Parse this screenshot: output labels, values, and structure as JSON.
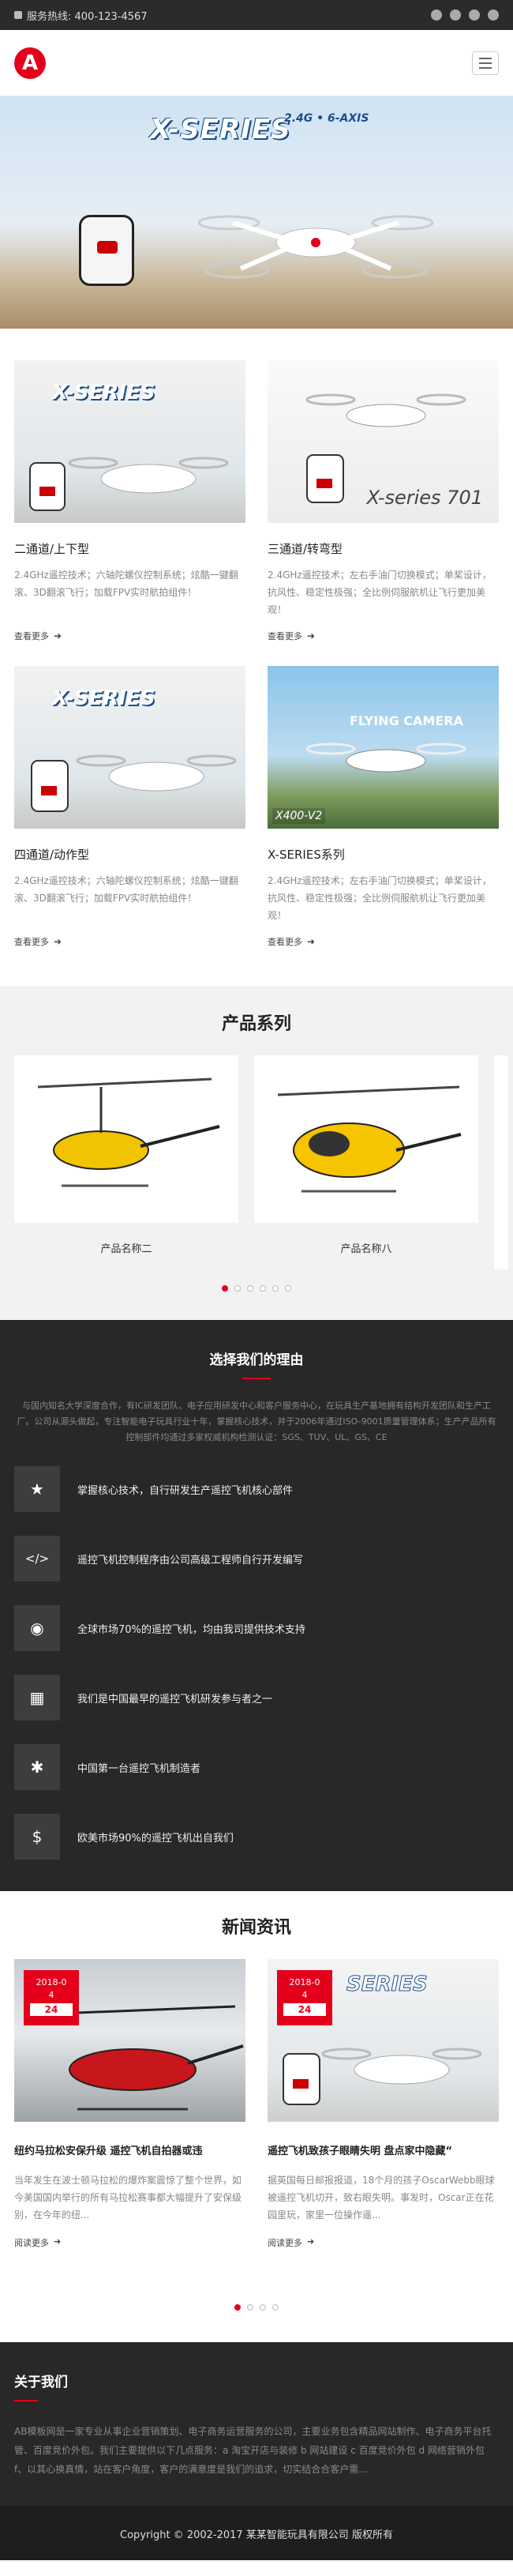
{
  "topbar": {
    "hotline": "服务热线: 400-123-4567",
    "social_icons": [
      "weibo-icon",
      "tencent-weibo-icon",
      "pinterest-icon",
      "qq-icon"
    ]
  },
  "header": {
    "logo_letter": "A",
    "menu_icon": "hamburger-icon"
  },
  "banner": {
    "brand": "X-SERIES",
    "spec": "2.4G • 6-AXIS"
  },
  "products": [
    {
      "title": "二通道/上下型",
      "desc": "2.4GHz遥控技术；六轴陀螺仪控制系统；炫酷一键翻滚、3D翻滚飞行；加载FPV实时航拍组件！",
      "more": "查看更多",
      "overlay": "X-SERIES",
      "tag": ""
    },
    {
      "title": "三通道/转弯型",
      "desc": "2.4GHz遥控技术；左右手油门切换模式；单桨设计，抗风性、稳定性极强；全比例伺服航机让飞行更加美观！",
      "more": "查看更多",
      "overlay": "",
      "tag": "X-series 701"
    },
    {
      "title": "四通道/动作型",
      "desc": "2.4GHz遥控技术；六轴陀螺仪控制系统；炫酷一键翻滚、3D翻滚飞行；加载FPV实时航拍组件！",
      "more": "查看更多",
      "overlay": "X-SERIES",
      "tag": ""
    },
    {
      "title": "X-SERIES系列",
      "desc": "2.4GHz遥控技术；左右手油门切换模式；单桨设计，抗风性、稳定性极强；全比例伺服航机让飞行更加美观！",
      "more": "查看更多",
      "overlay": "FLYING CAMERA",
      "tag": "X400-V2"
    }
  ],
  "series": {
    "title": "产品系列",
    "items": [
      {
        "name": "产品名称二"
      },
      {
        "name": "产品名称八"
      }
    ],
    "dots": 6
  },
  "reasons": {
    "title": "选择我们的理由",
    "intro": "与国内知名大学深度合作，有IC研发团队、电子应用研发中心和客户服务中心，在玩具生产基地拥有结构开发团队和生产工厂。公司从源头做起，专注智能电子玩具行业十年，掌握核心技术，并于2006年通过ISO-9001质量管理体系；生产产品所有控制部件均通过多家权威机构检测认证：SGS、TUV、UL、GS、CE",
    "items": [
      {
        "icon": "star-icon",
        "glyph": "★",
        "text": "掌握核心技术，自行研发生产遥控飞机核心部件"
      },
      {
        "icon": "code-icon",
        "glyph": "</>",
        "text": "遥控飞机控制程序由公司高级工程师自行开发编写"
      },
      {
        "icon": "globe-icon",
        "glyph": "◉",
        "text": "全球市场70%的遥控飞机，均由我司提供技术支持"
      },
      {
        "icon": "calendar-icon",
        "glyph": "▦",
        "text": "我们是中国最早的遥控飞机研发参与者之一"
      },
      {
        "icon": "asterisk-icon",
        "glyph": "✱",
        "text": "中国第一台遥控飞机制造者"
      },
      {
        "icon": "money-icon",
        "glyph": "$",
        "text": "欧美市场90%的遥控飞机出自我们"
      }
    ]
  },
  "news": {
    "title": "新闻资讯",
    "items": [
      {
        "date_ym": "2018-0",
        "date_m": "4",
        "day": "24",
        "title": "纽约马拉松安保升级 遥控飞机自拍器或违",
        "desc": "当年发生在波士顿马拉松的爆炸案震惊了整个世界，如今美国国内举行的所有马拉松赛事都大幅提升了安保级别，在今年的纽...",
        "more": "阅读更多"
      },
      {
        "date_ym": "2018-0",
        "date_m": "4",
        "day": "24",
        "title": "遥控飞机致孩子眼睛失明 盘点家中隐藏“",
        "desc": "据英国每日邮报报道，18个月的孩子OscarWebb眼球被遥控飞机切开，致右眼失明。事发时，Oscar正在花园里玩，家里一位操作遥...",
        "more": "阅读更多"
      }
    ],
    "dots": 4
  },
  "about": {
    "title": "关于我们",
    "text": "AB模板网是一家专业从事企业营销策划、电子商务运营服务的公司，主要业务包含精品网站制作、电子商务平台托管、百度竞价外包。我们主要提供以下几点服务：a 淘宝开店与装修 b 网站建设 c 百度竞价外包 d 网络营销外包 f、以其心换真情，站在客户角度，客户的满意度是我们的追求，切实结合合客户需..."
  },
  "footer": {
    "copyright": "Copyright © 2002-2017 某某智能玩具有限公司 版权所有"
  }
}
